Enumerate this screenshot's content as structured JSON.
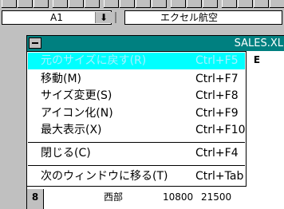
{
  "formula_bar": {
    "cell_ref": "A1",
    "dropdown_glyph": "⬇",
    "content": "エクセル航空"
  },
  "sheet": {
    "title": "SALES.XL",
    "column_e": "E",
    "row8": {
      "header": "8",
      "region": "西部",
      "val1": "10800",
      "val2": "21500"
    }
  },
  "menu": {
    "items": [
      {
        "label": "元のサイズに戻す(R)",
        "shortcut": "Ctrl+F5",
        "disabled": true,
        "selected": true
      },
      {
        "label": "移動(M)",
        "shortcut": "Ctrl+F7"
      },
      {
        "label": "サイズ変更(S)",
        "shortcut": "Ctrl+F8"
      },
      {
        "label": "アイコン化(N)",
        "shortcut": "Ctrl+F9"
      },
      {
        "label": "最大表示(X)",
        "shortcut": "Ctrl+F10"
      },
      {
        "label": "閉じる(C)",
        "shortcut": "Ctrl+F4"
      },
      {
        "label": "次のウィンドウに移る(T)",
        "shortcut": "Ctrl+Tab"
      }
    ]
  },
  "colors": {
    "titlebar": "#008080",
    "highlight": "#00ffff",
    "face": "#c0c0c0"
  }
}
